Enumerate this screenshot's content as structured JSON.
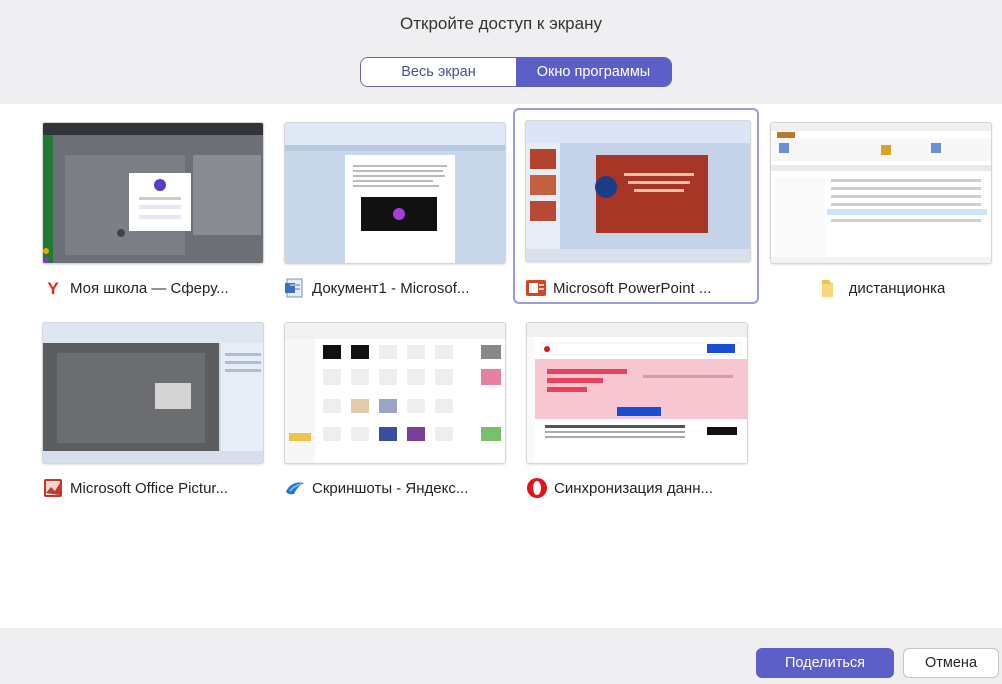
{
  "dialog": {
    "title": "Откройте доступ к экрану",
    "tab_full_screen": "Весь экран",
    "tab_program_window": "Окно программы"
  },
  "windows": [
    {
      "label": "Моя школа — Сферу...",
      "icon": "yandex-browser-icon"
    },
    {
      "label": "Документ1 - Microsof...",
      "icon": "word-document-icon"
    },
    {
      "label": "Microsoft PowerPoint ...",
      "icon": "powerpoint-icon",
      "selected": true
    },
    {
      "label": "дистанционка",
      "icon": "folder-icon"
    },
    {
      "label": "Microsoft Office Pictur...",
      "icon": "office-picture-manager-icon"
    },
    {
      "label": "Скриншоты - Яндекс...",
      "icon": "yandex-disk-icon"
    },
    {
      "label": "Синхронизация данн...",
      "icon": "opera-icon"
    }
  ],
  "footer": {
    "share_label": "Поделиться",
    "cancel_label": "Отмена"
  },
  "colors": {
    "accent": "#5b5fc7",
    "selected_border": "#9a9ddb"
  }
}
